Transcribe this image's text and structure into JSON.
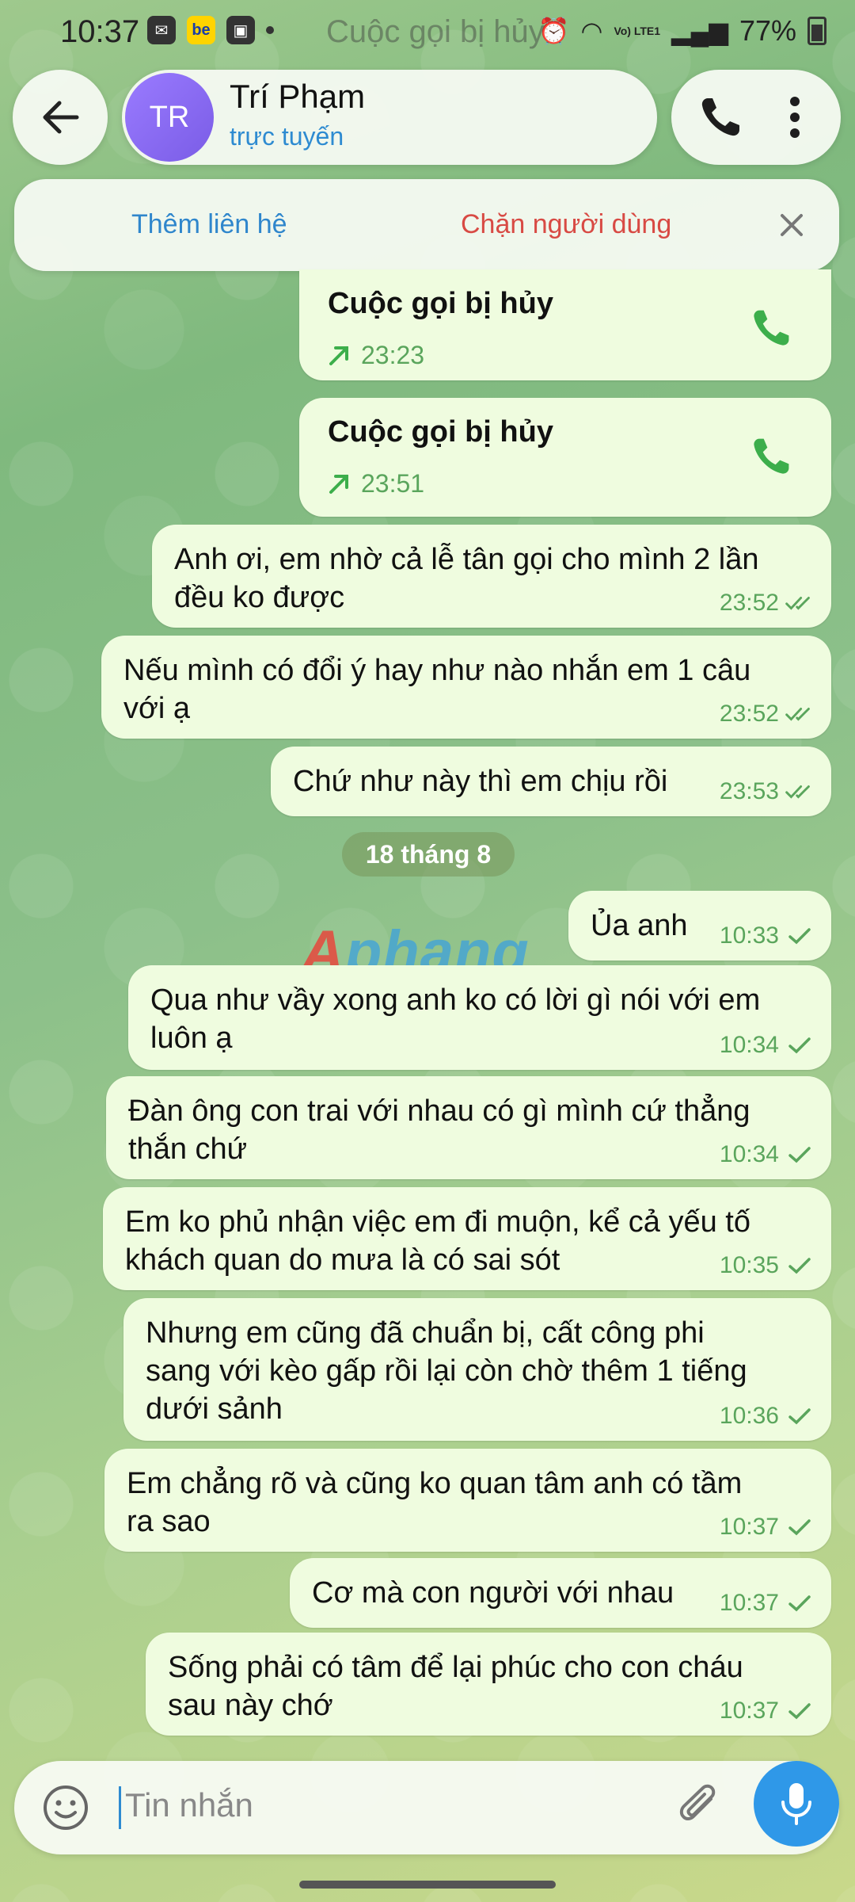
{
  "status_bar": {
    "time": "10:37",
    "ghost_text": "Cuộc gọi bị hủy",
    "battery": "77%",
    "network": "Vo) LTE1",
    "icons": [
      "messenger-icon",
      "be-app-icon",
      "gallery-icon",
      "alarm-icon",
      "wifi-icon",
      "signal-icon",
      "battery-icon"
    ]
  },
  "header": {
    "avatar_initials": "TR",
    "name": "Trí Phạm",
    "status": "trực tuyến"
  },
  "action_bar": {
    "add_contact": "Thêm liên hệ",
    "block_user": "Chặn người dùng"
  },
  "calls": [
    {
      "title": "Cuộc gọi bị hủy",
      "time": "23:23"
    },
    {
      "title": "Cuộc gọi bị hủy",
      "time": "23:51"
    }
  ],
  "messages_day1": [
    {
      "lines": [
        "Anh ơi, em nhờ cả lễ tân gọi cho mình 2 lần",
        "đều ko được"
      ],
      "time": "23:52",
      "read": true
    },
    {
      "lines": [
        "Nếu mình có đổi ý hay như nào nhắn em 1 câu",
        "với ạ"
      ],
      "time": "23:52",
      "read": true
    },
    {
      "lines": [
        "Chứ như này thì em chịu rồi"
      ],
      "time": "23:53",
      "read": true
    }
  ],
  "date_separator": "18 tháng 8",
  "watermark": {
    "part1": "A",
    "part2": "phang"
  },
  "messages_day2": [
    {
      "lines": [
        "Ủa anh"
      ],
      "time": "10:33",
      "read": false
    },
    {
      "lines": [
        "Qua như vầy xong anh ko có lời gì nói với em",
        "luôn ạ"
      ],
      "time": "10:34",
      "read": false
    },
    {
      "lines": [
        "Đàn ông con trai với nhau có gì mình cứ thẳng",
        "thắn chứ"
      ],
      "time": "10:34",
      "read": false
    },
    {
      "lines": [
        "Em ko phủ nhận việc em đi muộn, kể cả yếu tố",
        "khách quan do mưa là có sai sót"
      ],
      "time": "10:35",
      "read": false
    },
    {
      "lines": [
        "Nhưng em cũng đã chuẩn bị, cất công phi",
        "sang với kèo gấp rồi lại còn chờ thêm 1 tiếng",
        "dưới sảnh"
      ],
      "time": "10:36",
      "read": false
    },
    {
      "lines": [
        "Em chẳng rõ và cũng ko quan tâm anh có tầm",
        "ra sao"
      ],
      "time": "10:37",
      "read": false
    },
    {
      "lines": [
        "Cơ mà con người với nhau"
      ],
      "time": "10:37",
      "read": false
    },
    {
      "lines": [
        "Sống phải có tâm để lại phúc cho con cháu",
        "sau này chớ"
      ],
      "time": "10:37",
      "read": false
    }
  ],
  "input": {
    "placeholder": "Tin nhắn"
  },
  "colors": {
    "bubble": "#effcdf",
    "accent": "#2f98e8",
    "tick": "#5aa55c",
    "block": "#d84a44",
    "link": "#2f86cc"
  }
}
